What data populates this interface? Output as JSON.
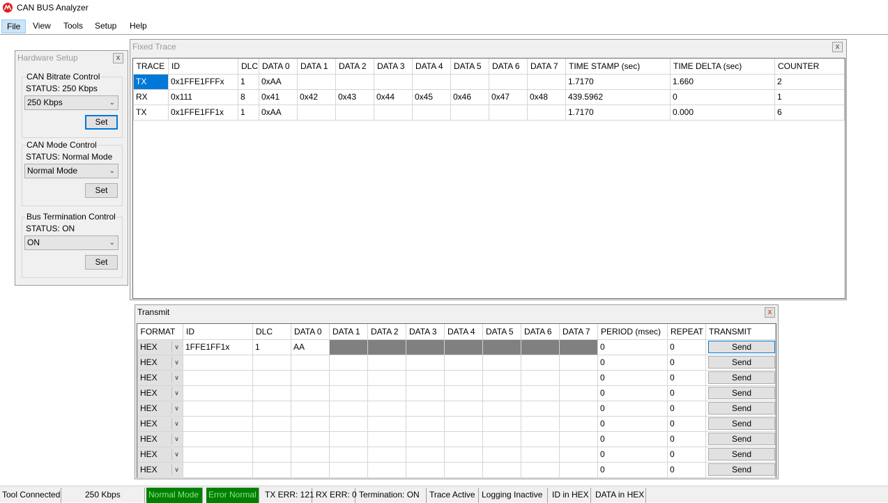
{
  "app": {
    "title": "CAN BUS Analyzer",
    "logo": "microchip-logo-icon",
    "brand_color": "#e31b23"
  },
  "menu": {
    "items": [
      "File",
      "View",
      "Tools",
      "Setup",
      "Help"
    ]
  },
  "hardware_setup": {
    "title": "Hardware Setup",
    "close": "x",
    "bitrate": {
      "legend": "CAN Bitrate Control",
      "status": "STATUS: 250 Kbps",
      "selected": "250 Kbps",
      "button": "Set"
    },
    "mode": {
      "legend": "CAN Mode Control",
      "status": "STATUS: Normal Mode",
      "selected": "Normal Mode",
      "button": "Set"
    },
    "termination": {
      "legend": "Bus Termination Control",
      "status": "STATUS: ON",
      "selected": "ON",
      "button": "Set"
    }
  },
  "fixed_trace": {
    "title": "Fixed Trace",
    "close": "x",
    "columns": [
      "TRACE",
      "ID",
      "DLC",
      "DATA 0",
      "DATA 1",
      "DATA 2",
      "DATA 3",
      "DATA 4",
      "DATA 5",
      "DATA 6",
      "DATA 7",
      "TIME STAMP (sec)",
      "TIME DELTA (sec)",
      "COUNTER"
    ],
    "rows": [
      [
        "TX",
        "0x1FFE1FFFx",
        "1",
        "0xAA",
        "",
        "",
        "",
        "",
        "",
        "",
        "",
        "1.7170",
        "1.660",
        "2"
      ],
      [
        "RX",
        "0x111",
        "8",
        "0x41",
        "0x42",
        "0x43",
        "0x44",
        "0x45",
        "0x46",
        "0x47",
        "0x48",
        "439.5962",
        "0",
        "1"
      ],
      [
        "TX",
        "0x1FFE1FF1x",
        "1",
        "0xAA",
        "",
        "",
        "",
        "",
        "",
        "",
        "",
        "1.7170",
        "0.000",
        "6"
      ]
    ]
  },
  "transmit": {
    "title": "Transmit",
    "close": "x",
    "columns": [
      "FORMAT",
      "ID",
      "DLC",
      "DATA 0",
      "DATA 1",
      "DATA 2",
      "DATA 3",
      "DATA 4",
      "DATA 5",
      "DATA 6",
      "DATA 7",
      "PERIOD (msec)",
      "REPEAT",
      "TRANSMIT"
    ],
    "rows": [
      {
        "format": "HEX",
        "id": "1FFE1FF1x",
        "dlc": "1",
        "data": [
          "AA",
          "",
          "",
          "",
          "",
          "",
          "",
          ""
        ],
        "period": "0",
        "repeat": "0",
        "send": "Send"
      },
      {
        "format": "HEX",
        "id": "",
        "dlc": "",
        "data": [
          "",
          "",
          "",
          "",
          "",
          "",
          "",
          ""
        ],
        "period": "0",
        "repeat": "0",
        "send": "Send"
      },
      {
        "format": "HEX",
        "id": "",
        "dlc": "",
        "data": [
          "",
          "",
          "",
          "",
          "",
          "",
          "",
          ""
        ],
        "period": "0",
        "repeat": "0",
        "send": "Send"
      },
      {
        "format": "HEX",
        "id": "",
        "dlc": "",
        "data": [
          "",
          "",
          "",
          "",
          "",
          "",
          "",
          ""
        ],
        "period": "0",
        "repeat": "0",
        "send": "Send"
      },
      {
        "format": "HEX",
        "id": "",
        "dlc": "",
        "data": [
          "",
          "",
          "",
          "",
          "",
          "",
          "",
          ""
        ],
        "period": "0",
        "repeat": "0",
        "send": "Send"
      },
      {
        "format": "HEX",
        "id": "",
        "dlc": "",
        "data": [
          "",
          "",
          "",
          "",
          "",
          "",
          "",
          ""
        ],
        "period": "0",
        "repeat": "0",
        "send": "Send"
      },
      {
        "format": "HEX",
        "id": "",
        "dlc": "",
        "data": [
          "",
          "",
          "",
          "",
          "",
          "",
          "",
          ""
        ],
        "period": "0",
        "repeat": "0",
        "send": "Send"
      },
      {
        "format": "HEX",
        "id": "",
        "dlc": "",
        "data": [
          "",
          "",
          "",
          "",
          "",
          "",
          "",
          ""
        ],
        "period": "0",
        "repeat": "0",
        "send": "Send"
      },
      {
        "format": "HEX",
        "id": "",
        "dlc": "",
        "data": [
          "",
          "",
          "",
          "",
          "",
          "",
          "",
          ""
        ],
        "period": "0",
        "repeat": "0",
        "send": "Send"
      }
    ]
  },
  "status_bar": {
    "items": [
      {
        "label": "Tool Connected",
        "style": "plain"
      },
      {
        "label": "250 Kbps",
        "style": "plain"
      },
      {
        "label": "Normal Mode",
        "style": "green"
      },
      {
        "label": "Error Normal",
        "style": "green"
      },
      {
        "label": "TX ERR: 121",
        "style": "plain"
      },
      {
        "label": "RX ERR: 0",
        "style": "plain"
      },
      {
        "label": "Termination: ON",
        "style": "plain"
      },
      {
        "label": "Trace Active",
        "style": "plain"
      },
      {
        "label": "Logging Inactive",
        "style": "plain"
      },
      {
        "label": "ID in HEX",
        "style": "plain"
      },
      {
        "label": "DATA in HEX",
        "style": "plain"
      }
    ],
    "status_green": "#008000"
  }
}
